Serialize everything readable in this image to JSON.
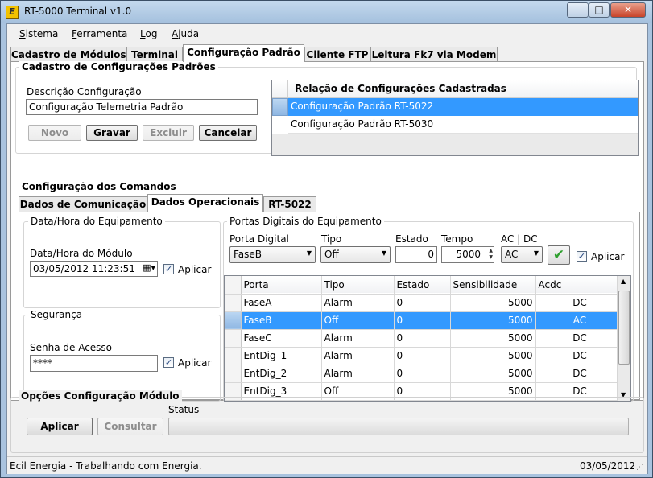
{
  "window": {
    "title": "RT-5000 Terminal v1.0",
    "icon_name": "app-icon",
    "icon_glyph": "E"
  },
  "caption_buttons": {
    "minimize": "–",
    "maximize": "□",
    "close": "✕"
  },
  "menu": [
    {
      "label": "Sistema",
      "underline": "S"
    },
    {
      "label": "Ferramenta",
      "underline": "F"
    },
    {
      "label": "Log",
      "underline": "L"
    },
    {
      "label": "Ajuda",
      "underline": "A"
    }
  ],
  "main_tabs": [
    "Cadastro de Módulos",
    "Terminal",
    "Configuração Padrão",
    "Cliente FTP",
    "Leitura Fk7 via Modem"
  ],
  "cadastro": {
    "group_title": "Cadastro de Configurações Padrões",
    "descricao_label": "Descrição Configuração",
    "descricao_value": "Configuração Telemetria Padrão",
    "buttons": {
      "novo": "Novo",
      "gravar": "Gravar",
      "excluir": "Excluir",
      "cancelar": "Cancelar"
    },
    "list_header": "Relação de Configurações Cadastradas",
    "list_items": [
      "Configuração Padrão RT-5022",
      "Configuração Padrão RT-5030"
    ]
  },
  "comandos": {
    "group_title": "Configuração dos Comandos",
    "tabs": [
      "Dados de Comunicação",
      "Dados Operacionais",
      "RT-5022"
    ],
    "datahora": {
      "group_title": "Data/Hora do Equipamento",
      "label": "Data/Hora do Módulo",
      "value": "03/05/2012 11:23:51",
      "aplicar": "Aplicar"
    },
    "seguranca": {
      "group_title": "Segurança",
      "label": "Senha de Acesso",
      "value": "****",
      "aplicar": "Aplicar"
    },
    "portas": {
      "group_title": "Portas Digitais do Equipamento",
      "labels": {
        "porta": "Porta Digital",
        "tipo": "Tipo",
        "estado": "Estado",
        "tempo": "Tempo",
        "acdc": "AC | DC"
      },
      "values": {
        "porta": "FaseB",
        "tipo": "Off",
        "estado": "0",
        "tempo": "5000",
        "acdc": "AC"
      },
      "aplicar": "Aplicar",
      "columns": [
        "Porta",
        "Tipo",
        "Estado",
        "Sensibilidade",
        "Acdc"
      ],
      "rows": [
        [
          "FaseA",
          "Alarm",
          "0",
          "5000",
          "DC"
        ],
        [
          "FaseB",
          "Off",
          "0",
          "5000",
          "AC"
        ],
        [
          "FaseC",
          "Alarm",
          "0",
          "5000",
          "DC"
        ],
        [
          "EntDig_1",
          "Alarm",
          "0",
          "5000",
          "DC"
        ],
        [
          "EntDig_2",
          "Alarm",
          "0",
          "5000",
          "DC"
        ],
        [
          "EntDig_3",
          "Off",
          "0",
          "5000",
          "DC"
        ]
      ]
    }
  },
  "opcoes": {
    "group_title": "Opções Configuração Módulo",
    "aplicar": "Aplicar",
    "consultar": "Consultar",
    "status_label": "Status",
    "progress": 0
  },
  "statusbar": {
    "left": "Ecil Energia - Trabalhando com Energia.",
    "right": "03/05/2012"
  },
  "colors": {
    "selection": "#3399ff",
    "titlebar": "#a9c3df",
    "close_button": "#c8442a"
  }
}
